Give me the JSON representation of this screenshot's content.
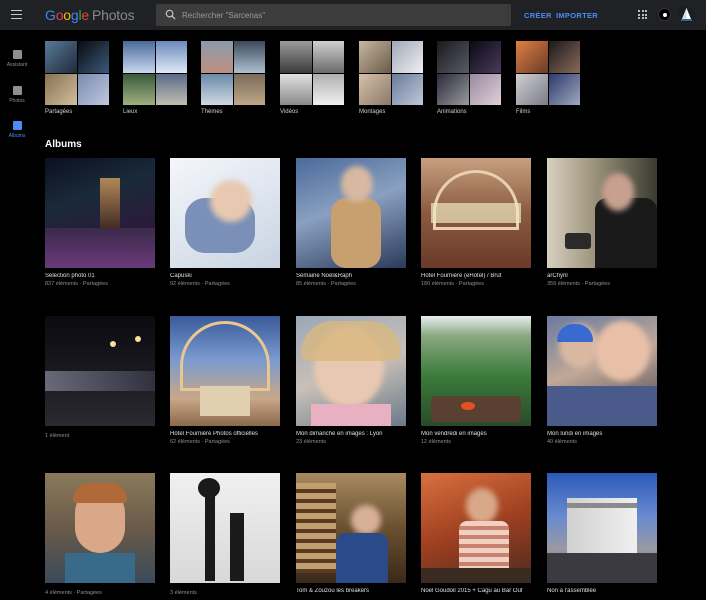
{
  "header": {
    "menu_icon": "hamburger-menu-icon",
    "logo_google": [
      "G",
      "o",
      "o",
      "g",
      "l",
      "e"
    ],
    "logo_product": "Photos",
    "search_placeholder": "Rechercher \"Sarcenas\"",
    "create_label": "CRÉER",
    "import_label": "IMPORTER",
    "icons": [
      "search-icon",
      "apps-grid-icon",
      "notifications-icon",
      "account-avatar-icon"
    ]
  },
  "sidebar": {
    "items": [
      {
        "label": "Assistant",
        "icon": "assistant-icon"
      },
      {
        "label": "Photos",
        "icon": "photos-icon"
      },
      {
        "label": "Albums",
        "icon": "albums-icon",
        "active": true
      }
    ]
  },
  "categories": [
    {
      "label": "Partagées"
    },
    {
      "label": "Lieux"
    },
    {
      "label": "Thèmes"
    },
    {
      "label": "Vidéos"
    },
    {
      "label": "Montages"
    },
    {
      "label": "Animations"
    },
    {
      "label": "Films"
    }
  ],
  "albums_heading": "Albums",
  "albums": [
    {
      "title": "Sélection photo 01",
      "count": "837 éléments",
      "shared": "Partagées"
    },
    {
      "title": "Capuski",
      "count": "92 éléments",
      "shared": "Partagées"
    },
    {
      "title": "Semaine Noël&Raph",
      "count": "85 éléments",
      "shared": "Partagées"
    },
    {
      "title": "Hotel Fournière (eHotel) / Brut",
      "count": "180 éléments",
      "shared": "Partagées"
    },
    {
      "title": "arChyril",
      "count": "359 éléments",
      "shared": "Partagées"
    },
    {
      "title": "",
      "count": "1 élément",
      "shared": ""
    },
    {
      "title": "Hotel Fournière Photos officielles",
      "count": "62 éléments",
      "shared": "Partagées"
    },
    {
      "title": "Mon dimanche en images : Lyon",
      "count": "23 éléments",
      "shared": ""
    },
    {
      "title": "Mon vendredi en images",
      "count": "12 éléments",
      "shared": ""
    },
    {
      "title": "Mon lundi en images",
      "count": "40 éléments",
      "shared": ""
    },
    {
      "title": "",
      "count": "4 éléments",
      "shared": "Partagées"
    },
    {
      "title": "",
      "count": "3 éléments",
      "shared": ""
    },
    {
      "title": "Tom & Zouzou les breakers",
      "count": "",
      "shared": ""
    },
    {
      "title": "Noel Goudoil 2015 + Cagu au Bar Ouf",
      "count": "",
      "shared": ""
    },
    {
      "title": "Non à l'assemblée",
      "count": "",
      "shared": ""
    }
  ],
  "colors": {
    "topbar": "#202124",
    "accent": "#4d8cf5",
    "background": "#000000"
  }
}
